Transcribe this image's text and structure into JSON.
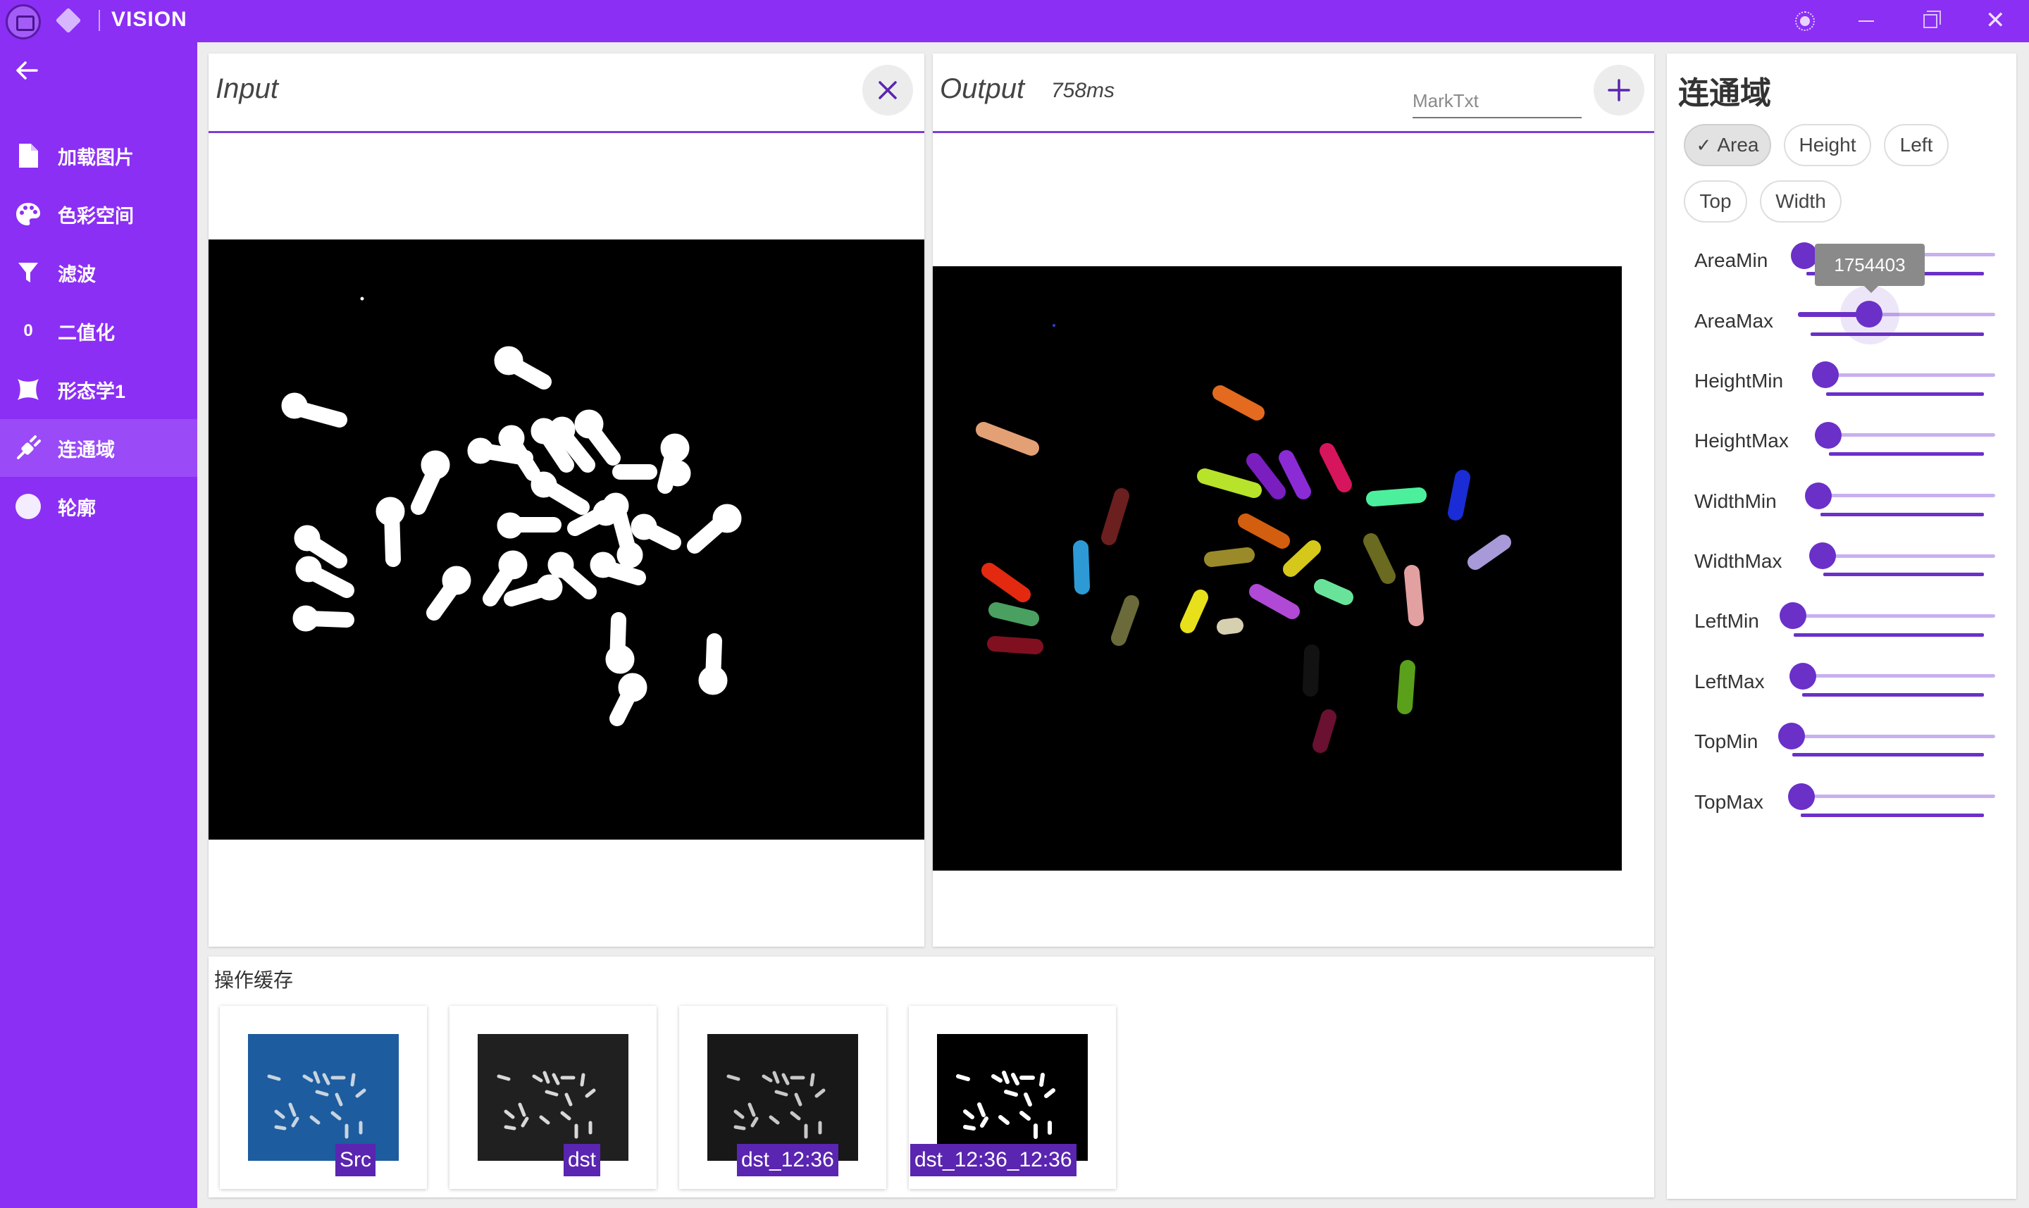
{
  "window": {
    "title": "VISION"
  },
  "sidebar": {
    "items": [
      {
        "label": "加载图片",
        "icon": "file-icon"
      },
      {
        "label": "色彩空间",
        "icon": "palette-icon"
      },
      {
        "label": "滤波",
        "icon": "filter-icon"
      },
      {
        "label": "二值化",
        "icon": "zero-icon"
      },
      {
        "label": "形态学1",
        "icon": "shape-icon"
      },
      {
        "label": "连通域",
        "icon": "plug-icon",
        "active": true
      },
      {
        "label": "轮廓",
        "icon": "circle-icon"
      }
    ]
  },
  "input_panel": {
    "title": "Input"
  },
  "output_panel": {
    "title": "Output",
    "time": "758ms",
    "mark_placeholder": "MarkTxt"
  },
  "right_panel": {
    "title": "连通域",
    "chips": [
      {
        "label": "Area",
        "selected": true
      },
      {
        "label": "Height",
        "selected": false
      },
      {
        "label": "Left",
        "selected": false
      },
      {
        "label": "Top",
        "selected": false
      },
      {
        "label": "Width",
        "selected": false
      }
    ],
    "sliders": [
      {
        "label": "AreaMin"
      },
      {
        "label": "AreaMax",
        "active": true
      },
      {
        "label": "HeightMin"
      },
      {
        "label": "HeightMax"
      },
      {
        "label": "WidthMin"
      },
      {
        "label": "WidthMax"
      },
      {
        "label": "LeftMin"
      },
      {
        "label": "LeftMax"
      },
      {
        "label": "TopMin"
      },
      {
        "label": "TopMax"
      }
    ],
    "tooltip": "1754403"
  },
  "cache": {
    "title": "操作缓存",
    "items": [
      {
        "label": "Src"
      },
      {
        "label": "dst"
      },
      {
        "label": "dst_12:36"
      },
      {
        "label": "dst_12:36_12:36"
      }
    ]
  },
  "colors": {
    "accent": "#8b2ff5",
    "accent_dark": "#6a30c8",
    "label_bg": "#5a25b0"
  }
}
